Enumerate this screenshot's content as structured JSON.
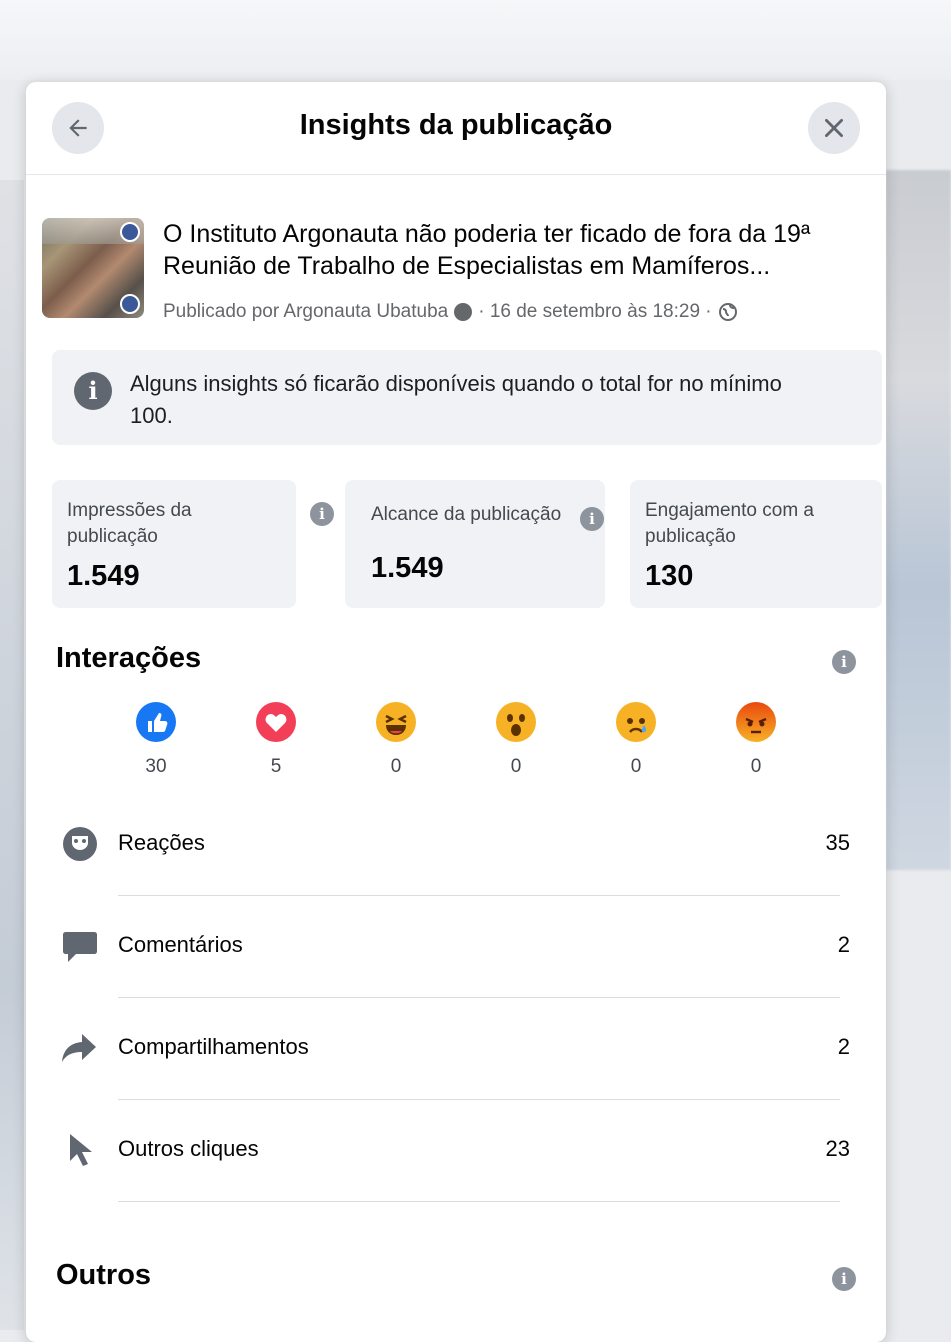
{
  "dialog": {
    "title": "Insights da publicação"
  },
  "post": {
    "text": "O Instituto Argonauta não poderia ter ficado de fora da 19ª Reunião de Trabalho de Especialistas em Mamíferos...",
    "meta_prefix": "Publicado por Argonauta Ubatuba",
    "meta_date": "· 16 de setembro às 18:29 ·"
  },
  "notice": {
    "text": "Alguns insights só ficarão disponíveis quando o total for no mínimo 100."
  },
  "metrics": [
    {
      "label": "Impressões da publicação",
      "value": "1.549"
    },
    {
      "label": "Alcance da publicação",
      "value": "1.549"
    },
    {
      "label": "Engajamento com a publicação",
      "value": "130"
    }
  ],
  "interactions": {
    "title": "Interações",
    "reactions": [
      {
        "icon": "like-icon",
        "count": "30",
        "color": "#1877f2"
      },
      {
        "icon": "love-icon",
        "count": "5",
        "color": "#f33e58"
      },
      {
        "icon": "haha-icon",
        "count": "0",
        "color": "#f7b125"
      },
      {
        "icon": "wow-icon",
        "count": "0",
        "color": "#f7b125"
      },
      {
        "icon": "sad-icon",
        "count": "0",
        "color": "#f7b125"
      },
      {
        "icon": "angry-icon",
        "count": "0",
        "color": "#e9710f"
      }
    ],
    "rows": [
      {
        "icon": "reactions-icon",
        "label": "Reações",
        "value": "35"
      },
      {
        "icon": "comment-icon",
        "label": "Comentários",
        "value": "2"
      },
      {
        "icon": "share-icon",
        "label": "Compartilhamentos",
        "value": "2"
      },
      {
        "icon": "cursor-icon",
        "label": "Outros cliques",
        "value": "23"
      }
    ]
  },
  "others": {
    "title": "Outros"
  }
}
